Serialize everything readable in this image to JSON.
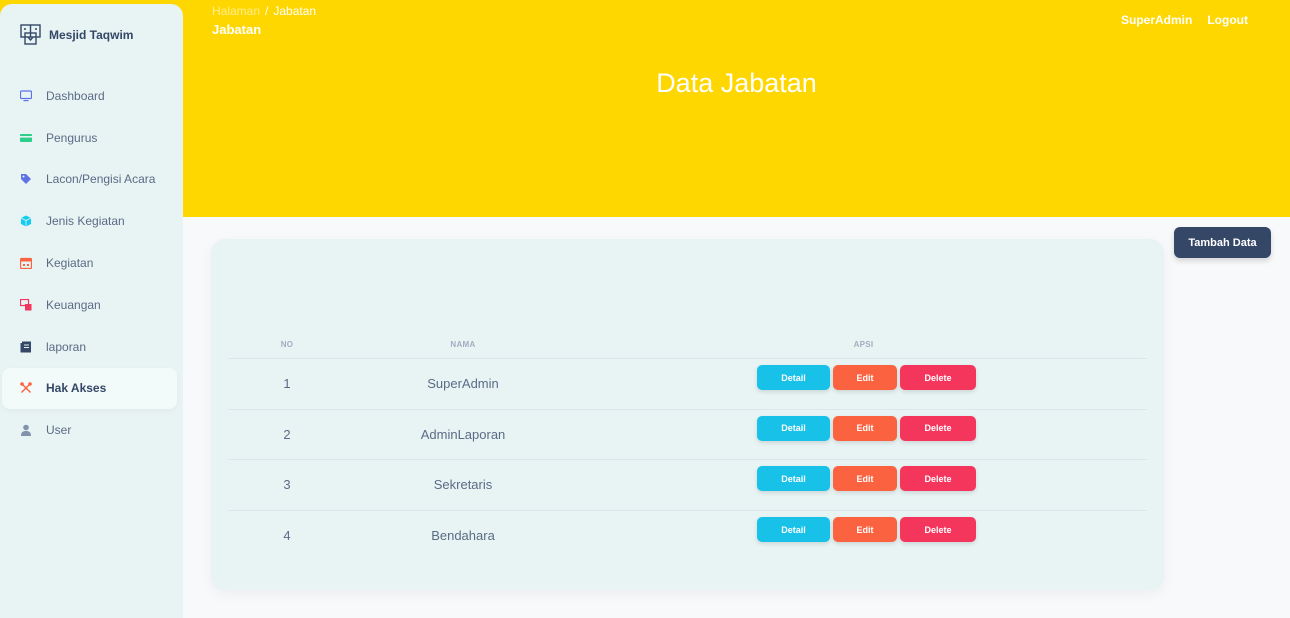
{
  "sidebar": {
    "brand": "Mesjid Taqwim",
    "items": [
      {
        "label": "Dashboard",
        "icon": "monitor-icon",
        "color": "#5e72e4"
      },
      {
        "label": "Pengurus",
        "icon": "credit-card-icon",
        "color": "#2dce89"
      },
      {
        "label": "Lacon/Pengisi Acara",
        "icon": "tag-icon",
        "color": "#5e72e4"
      },
      {
        "label": "Jenis Kegiatan",
        "icon": "box-icon",
        "color": "#11cdef"
      },
      {
        "label": "Kegiatan",
        "icon": "calendar-icon",
        "color": "#fb6340"
      },
      {
        "label": "Keuangan",
        "icon": "screen-icon",
        "color": "#f5365c"
      },
      {
        "label": "laporan",
        "icon": "document-icon",
        "color": "#344767"
      },
      {
        "label": "Hak Akses",
        "icon": "tools-icon",
        "color": "#fb6340"
      },
      {
        "label": "User",
        "icon": "user-icon",
        "color": "#8392ab"
      }
    ]
  },
  "header": {
    "breadcrumb_root": "Halaman",
    "breadcrumb_sep": "/",
    "breadcrumb_current": "Jabatan",
    "page_sub": "Jabatan",
    "user": "SuperAdmin",
    "logout": "Logout",
    "title": "Data Jabatan"
  },
  "toolbar": {
    "add_label": "Tambah Data"
  },
  "table": {
    "headers": {
      "no": "NO",
      "nama": "NAMA",
      "aksi": "APSI"
    },
    "rows": [
      {
        "no": "1",
        "nama": "SuperAdmin"
      },
      {
        "no": "2",
        "nama": "AdminLaporan"
      },
      {
        "no": "3",
        "nama": "Sekretaris"
      },
      {
        "no": "4",
        "nama": "Bendahara"
      }
    ],
    "buttons": {
      "detail": "Detail",
      "edit": "Edit",
      "delete": "Delete"
    }
  },
  "colors": {
    "header": "#ffd700",
    "sidebar": "#e8f3f3",
    "primary": "#344767",
    "detail": "#17c1e8",
    "edit": "#fb6340",
    "delete": "#f5365c"
  }
}
